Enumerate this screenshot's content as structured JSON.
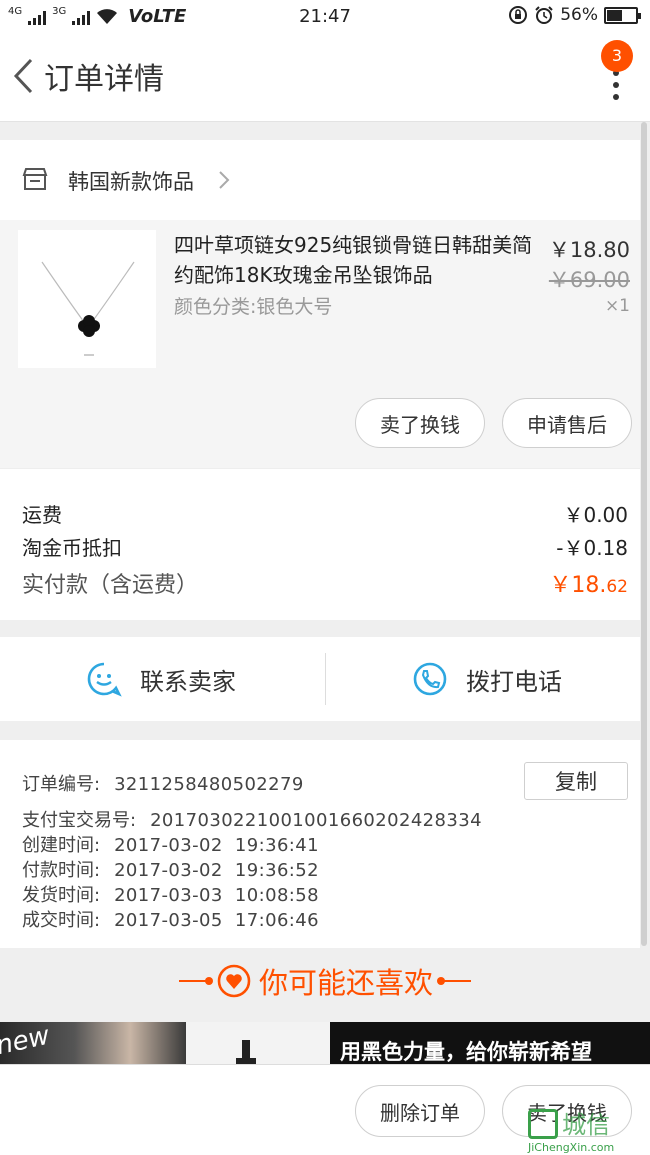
{
  "status_bar": {
    "net_1": "4G",
    "net_2": "3G",
    "volte": "VoLTE",
    "time": "21:47",
    "battery": "56%"
  },
  "header": {
    "title": "订单详情",
    "badge": "3"
  },
  "shop": {
    "name": "韩国新款饰品"
  },
  "product": {
    "name": "四叶草项链女925纯银锁骨链日韩甜美简约配饰18K玫瑰金吊坠银饰品",
    "variant": "颜色分类:银色大号",
    "price": "￥18.80",
    "old_price": "￥69.00",
    "quantity": "×1",
    "actions": [
      "卖了换钱",
      "申请售后"
    ]
  },
  "fees": {
    "shipping_label": "运费",
    "shipping_value": "￥0.00",
    "coin_label": "淘金币抵扣",
    "coin_value": "-￥0.18",
    "total_label": "实付款（含运费）",
    "total_value_main": "￥18.",
    "total_value_cents": "62"
  },
  "contact": {
    "seller": "联系卖家",
    "phone": "拨打电话"
  },
  "order_info": {
    "order_no_label": "订单编号:",
    "order_no": "3211258480502279",
    "copy_label": "复制",
    "alipay_label": "支付宝交易号:",
    "alipay_no": "2017030221001001660202428334",
    "created_label": "创建时间:",
    "created": "2017-03-02  19:36:41",
    "paid_label": "付款时间:",
    "paid": "2017-03-02  19:36:52",
    "shipped_label": "发货时间:",
    "shipped": "2017-03-03  10:08:58",
    "completed_label": "成交时间:",
    "completed": "2017-03-05  17:06:46"
  },
  "recommend": {
    "title": "你可能还喜欢",
    "banner_1": "new",
    "banner_3": "用黑色力量，给你崭新希望"
  },
  "bottom_bar": {
    "delete": "删除订单",
    "sell": "卖了换钱"
  },
  "watermark": {
    "text": "城信",
    "sub": "JiChengXin.com"
  },
  "colors": {
    "accent": "#ff5000",
    "icon_blue": "#2ea7e0"
  }
}
